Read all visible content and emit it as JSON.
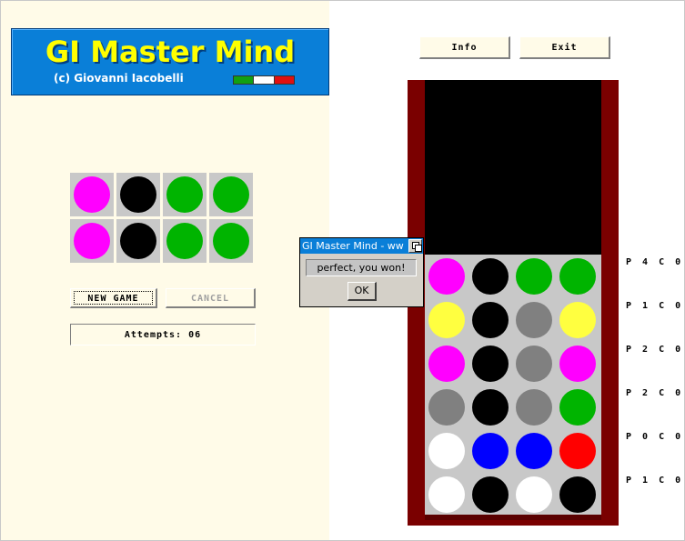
{
  "header": {
    "title": "GI Master Mind",
    "subtitle": "(c) Giovanni Iacobelli",
    "flag_colors": [
      "#12a012",
      "#ffffff",
      "#e01010"
    ]
  },
  "colors": {
    "magenta": "#ff00ff",
    "black": "#000000",
    "green": "#00b400",
    "yellow": "#ffff40",
    "grey": "#808080",
    "white": "#ffffff",
    "blue": "#0000ff",
    "red": "#ff0000"
  },
  "secret": {
    "rows": [
      [
        "magenta",
        "black",
        "green",
        "green"
      ],
      [
        "magenta",
        "black",
        "green",
        "green"
      ]
    ]
  },
  "controls": {
    "new_game_label": "NEW GAME",
    "cancel_label": "CANCEL",
    "attempts_text": "Attempts: 06"
  },
  "toolbar": {
    "info_label": "Info",
    "exit_label": "Exit"
  },
  "board": {
    "rows": [
      {
        "pegs": [
          "magenta",
          "black",
          "green",
          "green"
        ],
        "score": "P 4 C 0"
      },
      {
        "pegs": [
          "yellow",
          "black",
          "grey",
          "yellow"
        ],
        "score": "P 1 C 0"
      },
      {
        "pegs": [
          "magenta",
          "black",
          "grey",
          "magenta"
        ],
        "score": "P 2 C 0"
      },
      {
        "pegs": [
          "grey",
          "black",
          "grey",
          "green"
        ],
        "score": "P 2 C 0"
      },
      {
        "pegs": [
          "white",
          "blue",
          "blue",
          "red"
        ],
        "score": "P 0 C 0"
      },
      {
        "pegs": [
          "white",
          "black",
          "white",
          "black"
        ],
        "score": "P 1 C 0"
      }
    ]
  },
  "dialog": {
    "title": "GI Master Mind - ww",
    "message": "perfect, you won!",
    "ok_label": "OK"
  }
}
